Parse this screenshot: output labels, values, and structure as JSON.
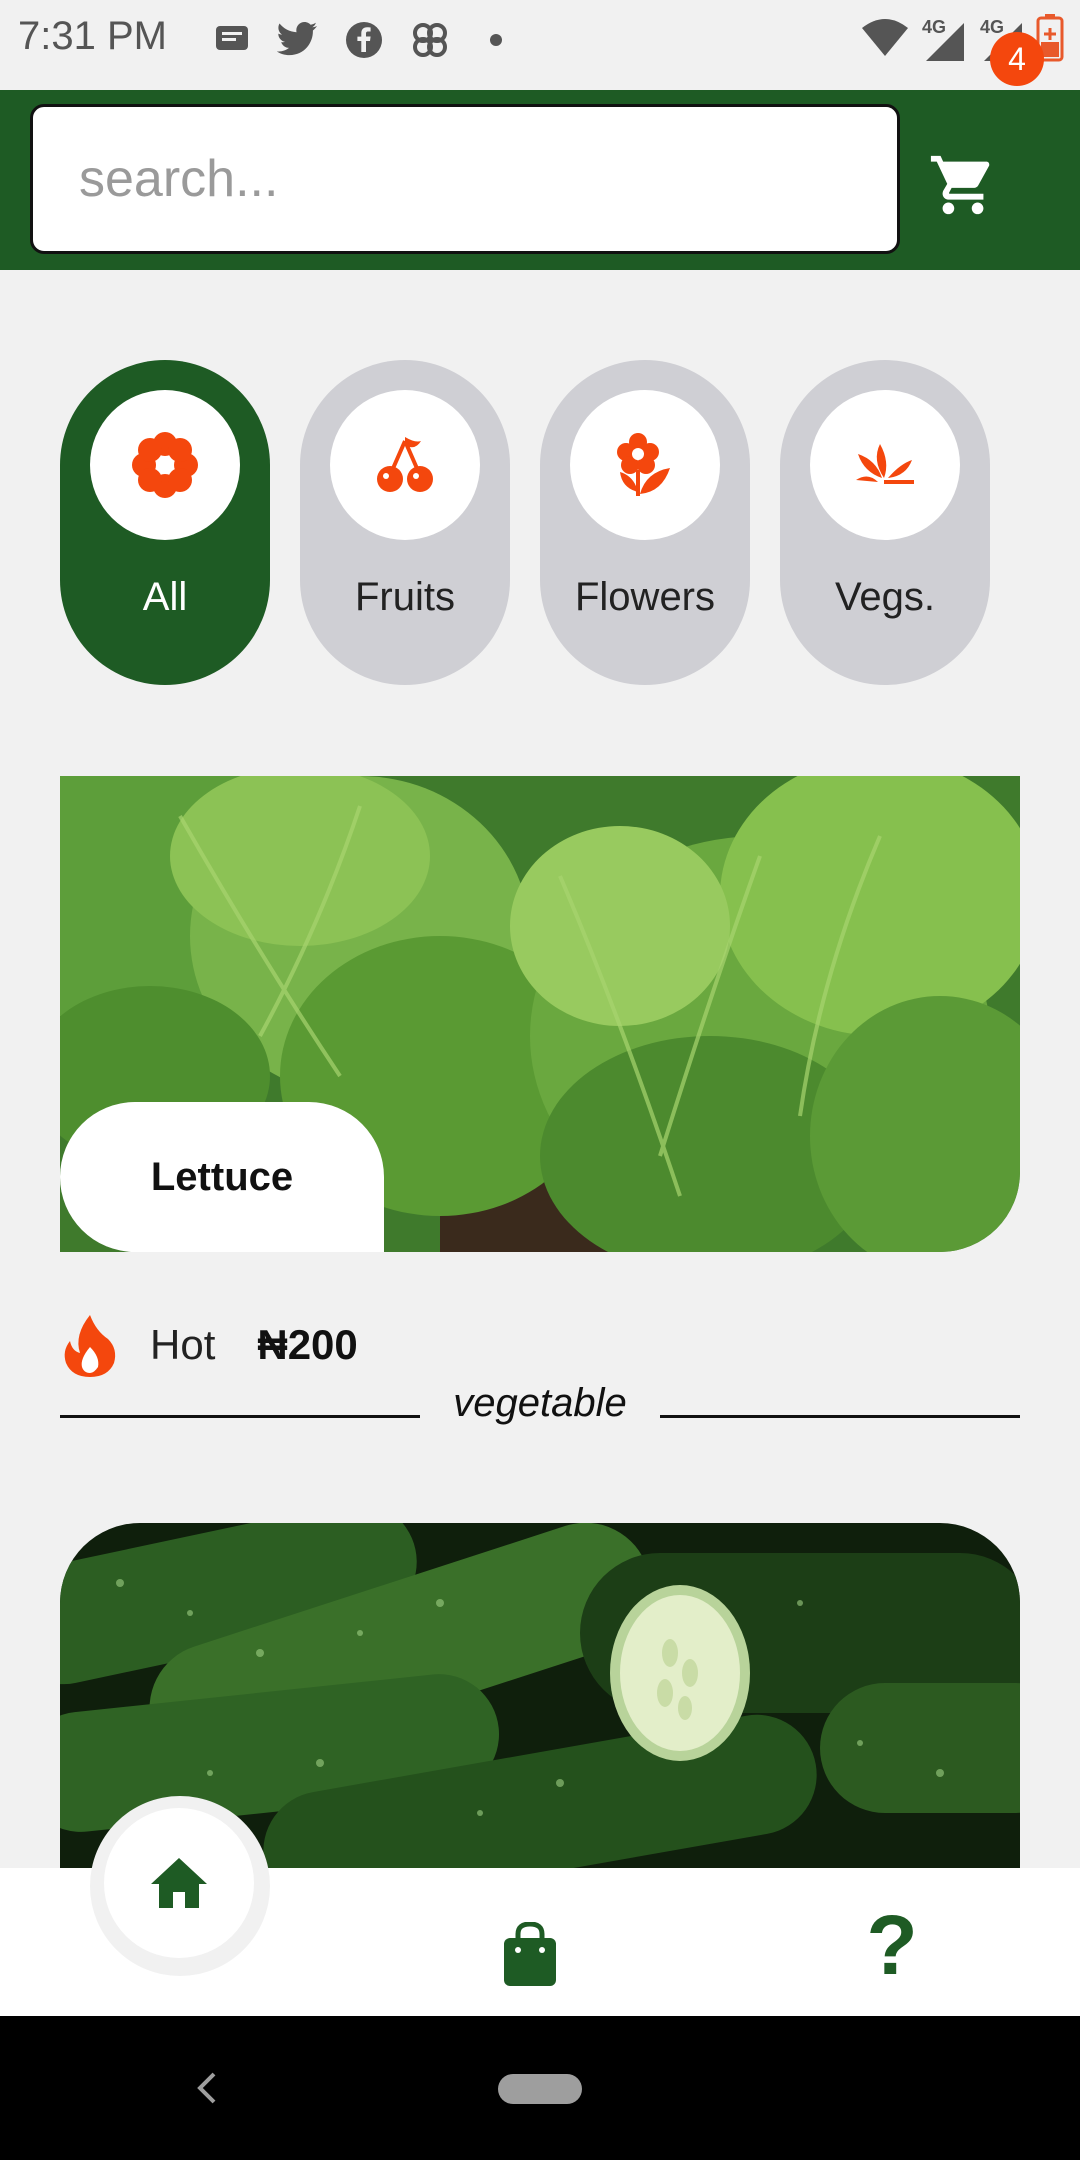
{
  "status_bar": {
    "time": "7:31 PM",
    "icons_left": [
      "message-icon",
      "twitter-icon",
      "facebook-icon",
      "pinwheel-icon",
      "dot-icon"
    ],
    "icons_right": [
      "wifi-icon",
      "signal-4g-icon",
      "signal-4g-icon",
      "battery-icon"
    ],
    "network_label_1": "4G",
    "network_label_2": "4G"
  },
  "header": {
    "search_placeholder": "search...",
    "cart_count": "4",
    "colors": {
      "header_bg": "#1e5b24",
      "badge": "#f4470d"
    }
  },
  "categories": [
    {
      "label": "All",
      "icon": "flower-gear-icon",
      "active": true
    },
    {
      "label": "Fruits",
      "icon": "cherries-icon",
      "active": false
    },
    {
      "label": "Flowers",
      "icon": "flower-leaf-icon",
      "active": false
    },
    {
      "label": "Vegs.",
      "icon": "sprout-icon",
      "active": false
    }
  ],
  "products": [
    {
      "name": "Lettuce",
      "badge": "Hot",
      "price": "₦200",
      "category": "vegetable",
      "image": "lettuce-image"
    },
    {
      "image": "cucumber-image"
    }
  ],
  "bottom_nav": {
    "items": [
      "home-icon",
      "shopping-bag-icon",
      "help-icon"
    ],
    "help_glyph": "?"
  },
  "accent_color": "#f4470d",
  "brand_color": "#1e5b24"
}
